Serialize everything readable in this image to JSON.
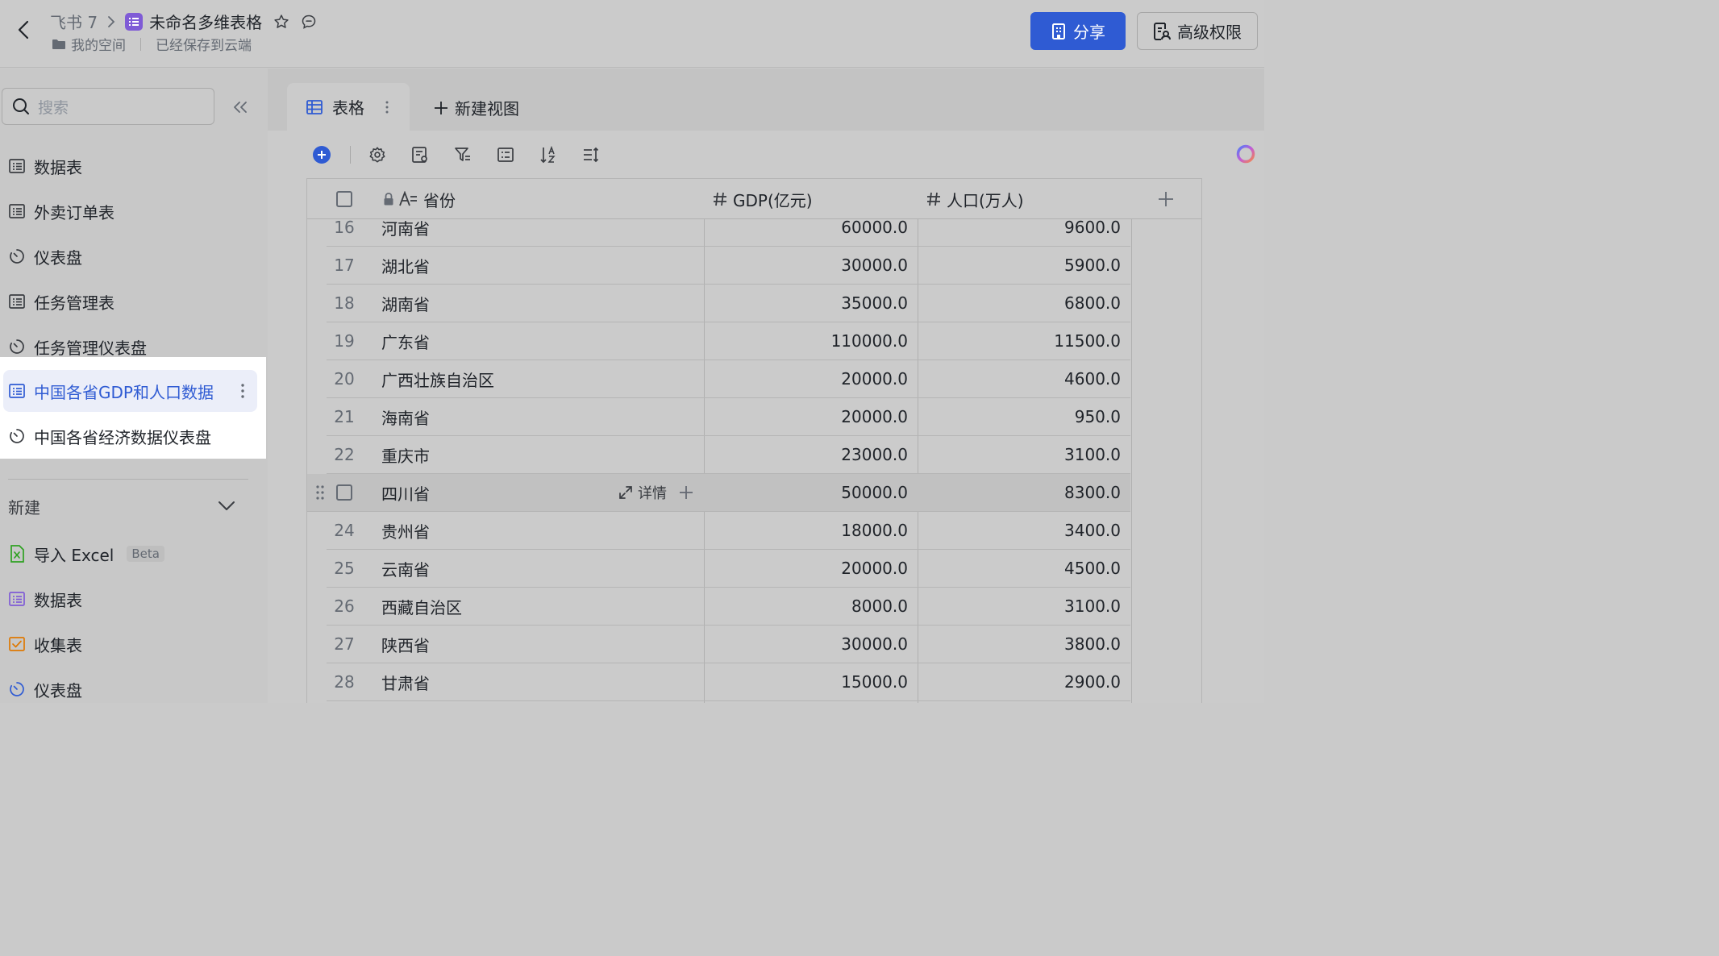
{
  "header": {
    "parent": "飞书 7",
    "title": "未命名多维表格",
    "location": "我的空间",
    "save_status": "已经保存到云端",
    "share_label": "分享",
    "perm_label": "高级权限"
  },
  "sidebar": {
    "search_placeholder": "搜索",
    "items": [
      {
        "label": "数据表",
        "icon": "table-icon"
      },
      {
        "label": "外卖订单表",
        "icon": "table-icon"
      },
      {
        "label": "仪表盘",
        "icon": "dashboard-icon"
      },
      {
        "label": "任务管理表",
        "icon": "table-icon"
      },
      {
        "label": "任务管理仪表盘",
        "icon": "dashboard-icon"
      },
      {
        "label": "中国各省GDP和人口数据",
        "icon": "table-icon",
        "active": true
      },
      {
        "label": "中国各省经济数据仪表盘",
        "icon": "dashboard-icon"
      }
    ],
    "new_section": {
      "label": "新建",
      "items": [
        {
          "label": "导入 Excel",
          "badge": "Beta",
          "icon": "excel-icon",
          "color": "#2ea121"
        },
        {
          "label": "数据表",
          "icon": "table-icon",
          "color": "#7f5bd6"
        },
        {
          "label": "收集表",
          "icon": "form-icon",
          "color": "#de7802"
        },
        {
          "label": "仪表盘",
          "icon": "dashboard-icon",
          "color": "#2f5bd3"
        }
      ]
    }
  },
  "view_tabs": {
    "active_label": "表格",
    "new_view_label": "新建视图"
  },
  "grid": {
    "columns": [
      "省份",
      "GDP(亿元)",
      "人口(万人)"
    ],
    "hover_row_detail": "详情",
    "rows": [
      {
        "num": "16",
        "name": "河南省",
        "gdp": "60000.0",
        "pop": "9600.0"
      },
      {
        "num": "17",
        "name": "湖北省",
        "gdp": "30000.0",
        "pop": "5900.0"
      },
      {
        "num": "18",
        "name": "湖南省",
        "gdp": "35000.0",
        "pop": "6800.0"
      },
      {
        "num": "19",
        "name": "广东省",
        "gdp": "110000.0",
        "pop": "11500.0"
      },
      {
        "num": "20",
        "name": "广西壮族自治区",
        "gdp": "20000.0",
        "pop": "4600.0"
      },
      {
        "num": "21",
        "name": "海南省",
        "gdp": "20000.0",
        "pop": "950.0"
      },
      {
        "num": "22",
        "name": "重庆市",
        "gdp": "23000.0",
        "pop": "3100.0"
      },
      {
        "num": "",
        "name": "四川省",
        "gdp": "50000.0",
        "pop": "8300.0",
        "hover": true
      },
      {
        "num": "24",
        "name": "贵州省",
        "gdp": "18000.0",
        "pop": "3400.0"
      },
      {
        "num": "25",
        "name": "云南省",
        "gdp": "20000.0",
        "pop": "4500.0"
      },
      {
        "num": "26",
        "name": "西藏自治区",
        "gdp": "8000.0",
        "pop": "3100.0"
      },
      {
        "num": "27",
        "name": "陕西省",
        "gdp": "30000.0",
        "pop": "3800.0"
      },
      {
        "num": "28",
        "name": "甘肃省",
        "gdp": "15000.0",
        "pop": "2900.0"
      }
    ]
  },
  "colors": {
    "accent": "#2f5bd3",
    "doc_icon": "#7f5bd6"
  }
}
